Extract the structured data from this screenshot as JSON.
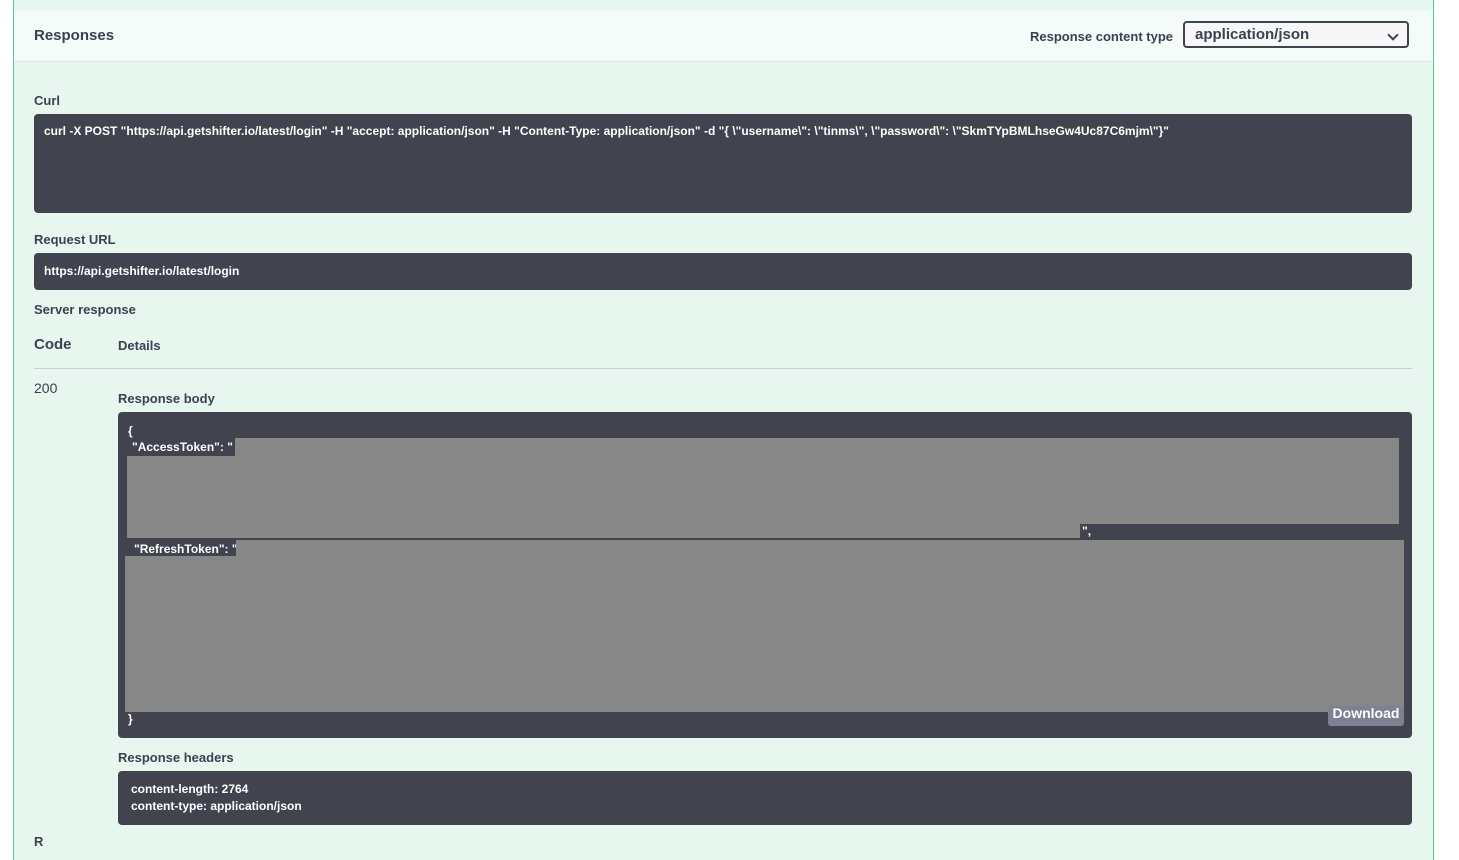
{
  "responses": {
    "title": "Responses",
    "content_type_label": "Response content type",
    "content_type_value": "application/json"
  },
  "curl": {
    "label": "Curl",
    "command": "curl -X POST \"https://api.getshifter.io/latest/login\" -H \"accept: application/json\" -H \"Content-Type: application/json\" -d \"{ \\\"username\\\": \\\"tinms\\\", \\\"password\\\": \\\"SkmTYpBMLhseGw4Uc87C6mjm\\\"}\""
  },
  "request_url": {
    "label": "Request URL",
    "value": "https://api.getshifter.io/latest/login"
  },
  "server_response": {
    "label": "Server response",
    "col_code": "Code",
    "col_details": "Details",
    "status_code": "200",
    "body_label": "Response body",
    "body_open": "{",
    "access_token_key": "\"AccessToken\": \"",
    "access_token_end": "\",",
    "refresh_token_key": "\"RefreshToken\": \"",
    "body_close": "}",
    "download_label": "Download",
    "headers_label": "Response headers",
    "header_lines": [
      "content-length: 2764",
      "content-type: application/json"
    ]
  },
  "next_section_label": "R"
}
